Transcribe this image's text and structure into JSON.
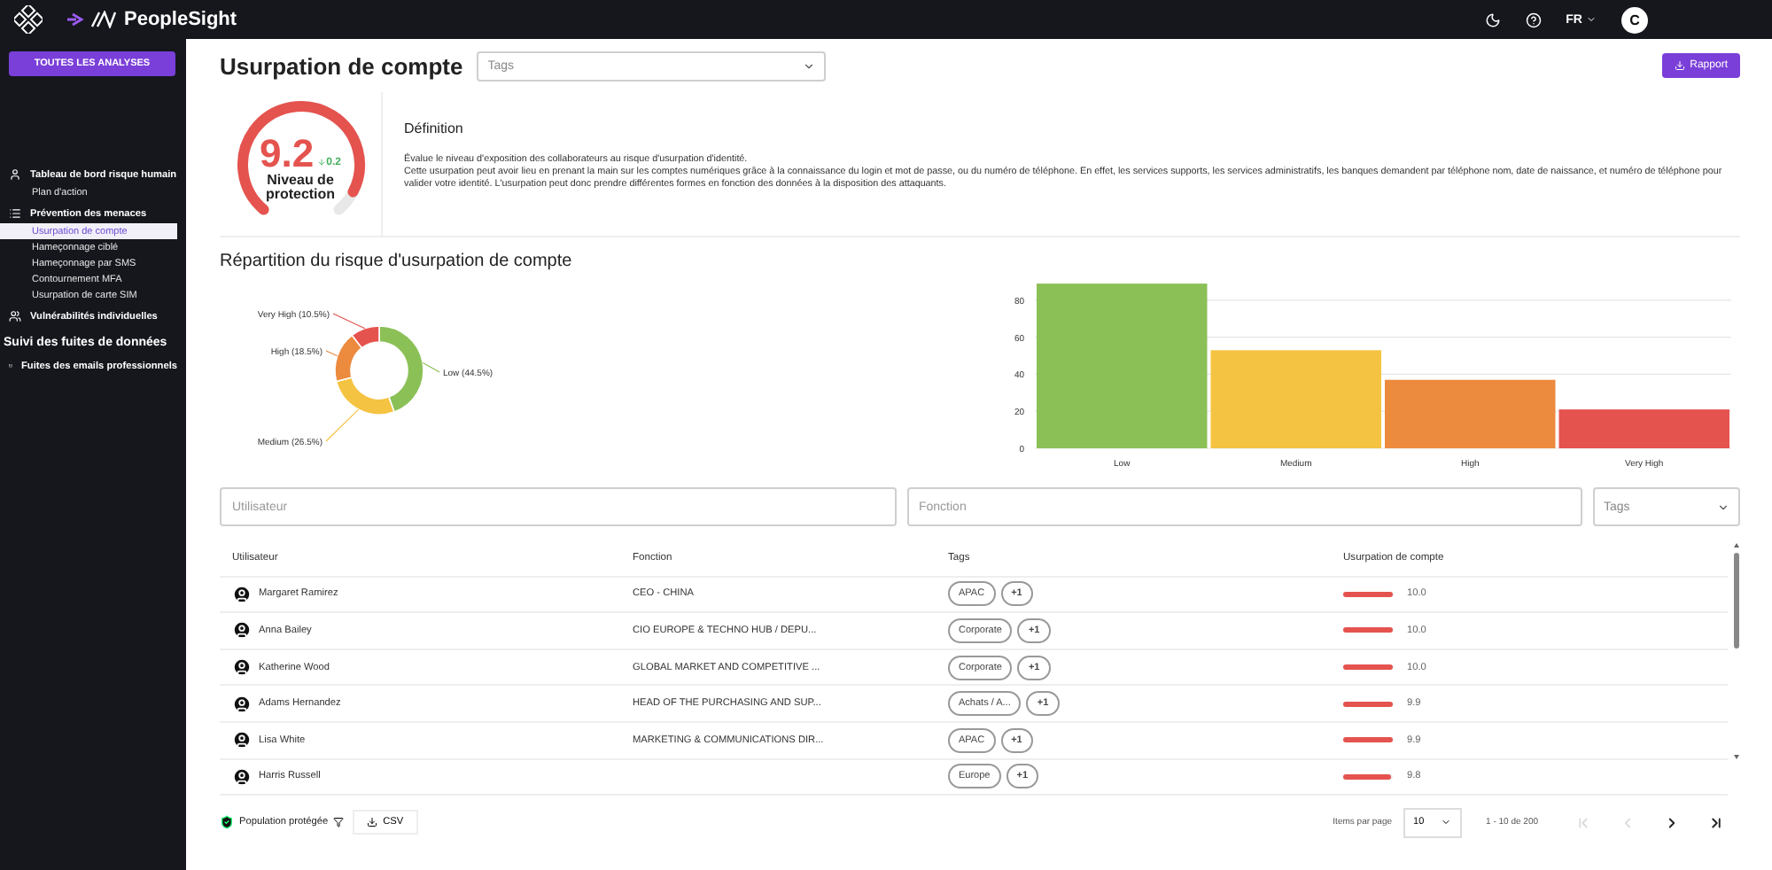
{
  "topbar": {
    "brand": "PeopleSight",
    "language": "FR",
    "avatar": "C"
  },
  "sidebar": {
    "all_button": "TOUTES LES ANALYSES",
    "items": [
      {
        "kind": "person",
        "label": "Tableau de bord risque humain",
        "children": [
          {
            "label": "Plan d'action",
            "selected": false
          }
        ]
      },
      {
        "kind": "list",
        "label": "Prévention des menaces",
        "children": [
          {
            "label": "Usurpation de compte",
            "selected": true
          },
          {
            "label": "Hameçonnage ciblé",
            "selected": false
          },
          {
            "label": "Hameçonnage par SMS",
            "selected": false
          },
          {
            "label": "Contournement MFA",
            "selected": false
          },
          {
            "label": "Usurpation de carte SIM",
            "selected": false
          }
        ]
      },
      {
        "kind": "people",
        "label": "Vulnérabilités individuelles"
      },
      {
        "kind": "heading",
        "label": "Suivi des fuites de données"
      },
      {
        "kind": "mail",
        "label": "Fuites des emails professionnels"
      }
    ]
  },
  "header": {
    "title": "Usurpation de compte",
    "tags_placeholder": "Tags",
    "report_button": "Rapport"
  },
  "gauge": {
    "value": "9.2",
    "delta": "0.2",
    "label": "Niveau de protection",
    "level": 0.92
  },
  "definition": {
    "title": "Définition",
    "lines": [
      "Évalue le niveau d'exposition des collaborateurs au risque d'usurpation d'identité.",
      "Cette usurpation peut avoir lieu en prenant la main sur les comptes numériques grâce à la connaissance du login et mot de passe, ou du numéro de téléphone. En effet, les services supports, les services administratifs, les banques demandent par téléphone nom, date de naissance, et numéro de téléphone pour valider votre identité. L'usurpation peut donc prendre différentes formes en fonction des données à la disposition des attaquants."
    ]
  },
  "distribution": {
    "title": "Répartition du risque d'usurpation de compte",
    "donut": {
      "chart_data": {
        "type": "donut",
        "categories": [
          "Low (44.5%)",
          "Medium (26.5%)",
          "High (18.5%)",
          "Very High (10.5%)"
        ],
        "values": [
          44.5,
          26.5,
          18.5,
          10.5
        ],
        "colors": [
          "#8bc057",
          "#f5c342",
          "#ec8a3e",
          "#e5534f"
        ]
      }
    },
    "bars": {
      "chart_data": {
        "type": "bar",
        "categories": [
          "Low",
          "Medium",
          "High",
          "Very High"
        ],
        "values": [
          89,
          53,
          37,
          21
        ],
        "colors": [
          "#8bc057",
          "#f5c342",
          "#ec8a3e",
          "#e5534f"
        ],
        "ylim": [
          0,
          90
        ],
        "yticks": [
          0,
          20,
          40,
          60,
          80
        ],
        "grid": true
      }
    }
  },
  "filters": {
    "user_placeholder": "Utilisateur",
    "function_placeholder": "Fonction",
    "tags_placeholder": "Tags"
  },
  "table": {
    "columns": [
      "Utilisateur",
      "Fonction",
      "Tags",
      "Usurpation de compte"
    ],
    "rows": [
      {
        "user": "Margaret Ramirez",
        "function": "CEO - CHINA",
        "tags": [
          "APAC"
        ],
        "more": "+1",
        "score": "10.0",
        "level": 1.0
      },
      {
        "user": "Anna Bailey",
        "function": "CIO EUROPE & TECHNO HUB / DEPU...",
        "tags": [
          "Corporate"
        ],
        "more": "+1",
        "score": "10.0",
        "level": 1.0
      },
      {
        "user": "Katherine Wood",
        "function": "GLOBAL MARKET AND COMPETITIVE ...",
        "tags": [
          "Corporate"
        ],
        "more": "+1",
        "score": "10.0",
        "level": 1.0
      },
      {
        "user": "Adams Hernandez",
        "function": "HEAD OF THE PURCHASING AND SUP...",
        "tags": [
          "Achats / A..."
        ],
        "more": "+1",
        "score": "9.9",
        "level": 0.99
      },
      {
        "user": "Lisa White",
        "function": "MARKETING & COMMUNICATIONS DIR...",
        "tags": [
          "APAC"
        ],
        "more": "+1",
        "score": "9.9",
        "level": 0.99
      },
      {
        "user": "Harris Russell",
        "tags": [
          "Europe"
        ],
        "more": "+1",
        "score": "9.8",
        "level": 0.98
      }
    ]
  },
  "footer": {
    "population": "Population protégée",
    "csv": "CSV",
    "items_per_page": "Items par page",
    "page_size": "10",
    "range": "1 - 10 de 200",
    "pager": [
      {
        "kind": "first",
        "disabled": true
      },
      {
        "kind": "prev",
        "disabled": true
      },
      {
        "kind": "next",
        "disabled": false
      },
      {
        "kind": "last",
        "disabled": false
      }
    ]
  }
}
